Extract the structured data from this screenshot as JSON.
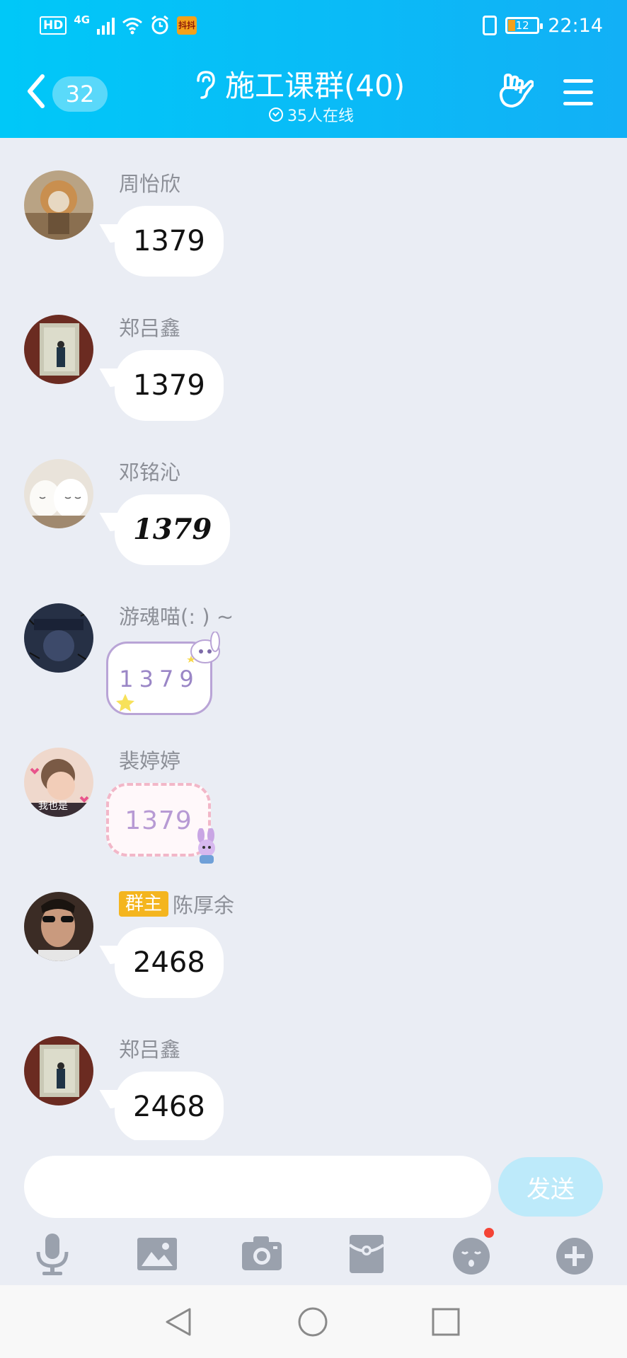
{
  "status_bar": {
    "hd": "HD",
    "network": "4G",
    "app_icon_text": "抖抖",
    "battery": "12",
    "time": "22:14"
  },
  "header": {
    "unread_count": "32",
    "title": "施工课群(40)",
    "online": "35人在线"
  },
  "messages": [
    {
      "sender": "周怡欣",
      "text": "1379",
      "style": "plain"
    },
    {
      "sender": "郑吕鑫",
      "text": "1379",
      "style": "plain"
    },
    {
      "sender": "邓铭沁",
      "text": "1379",
      "style": "handwritten"
    },
    {
      "sender": "游魂喵(: ) ~",
      "text": "1379",
      "style": "sticker-bunny"
    },
    {
      "sender": "裴婷婷",
      "text": "1379",
      "style": "sticker-pink",
      "avatar_caption": "我也是"
    },
    {
      "sender": "陈厚余",
      "role": "群主",
      "text": "2468",
      "style": "plain"
    },
    {
      "sender": "郑吕鑫",
      "text": "2468",
      "style": "plain"
    }
  ],
  "input": {
    "value": "",
    "send_label": "发送"
  },
  "toolbar": {
    "icons": [
      "microphone-icon",
      "image-icon",
      "camera-icon",
      "red-packet-icon",
      "emoji-icon",
      "plus-icon"
    ]
  },
  "nav": {
    "icons": [
      "back-triangle-icon",
      "home-circle-icon",
      "recents-square-icon"
    ]
  },
  "colors": {
    "header_start": "#00c8f8",
    "header_end": "#12b0f6",
    "background": "#eaedf4",
    "owner_badge": "#f4b51f",
    "send_disabled": "#bdeafa"
  }
}
